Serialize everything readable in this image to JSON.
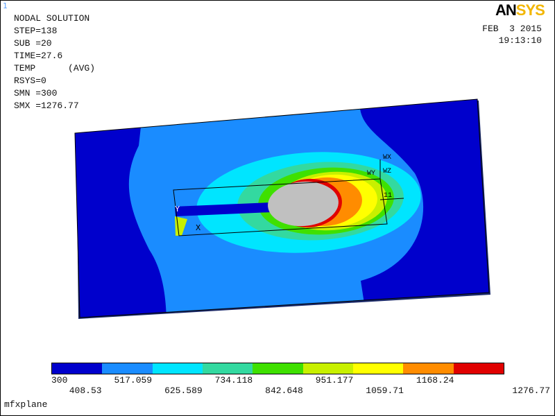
{
  "window_number": "1",
  "logo": {
    "an": "AN",
    "sys": "SYS"
  },
  "info": {
    "line1": "NODAL SOLUTION",
    "line2": "STEP=138",
    "line3": "SUB =20",
    "line4": "TIME=27.6",
    "line5": "TEMP      (AVG)",
    "line6": "RSYS=0",
    "line7": "SMN =300",
    "line8": "SMX =1276.77"
  },
  "date": {
    "line1": "FEB  3 2015",
    "line2": "19:13:10"
  },
  "triad": {
    "x": "X",
    "y": "Y",
    "wx": "WX",
    "wy": "WY",
    "wz": "WZ",
    "node": "11"
  },
  "legend": {
    "colors": [
      "#0000cc",
      "#1a8cff",
      "#00e5ff",
      "#33d9a0",
      "#3fe000",
      "#c8f000",
      "#ffff00",
      "#ff8c00",
      "#e00000"
    ],
    "top_labels": [
      "300",
      "517.059",
      "734.118",
      "951.177",
      "1168.24"
    ],
    "bottom_labels": [
      "408.53",
      "625.589",
      "842.648",
      "1059.71",
      "1276.77"
    ]
  },
  "model_name": "mfxplane"
}
